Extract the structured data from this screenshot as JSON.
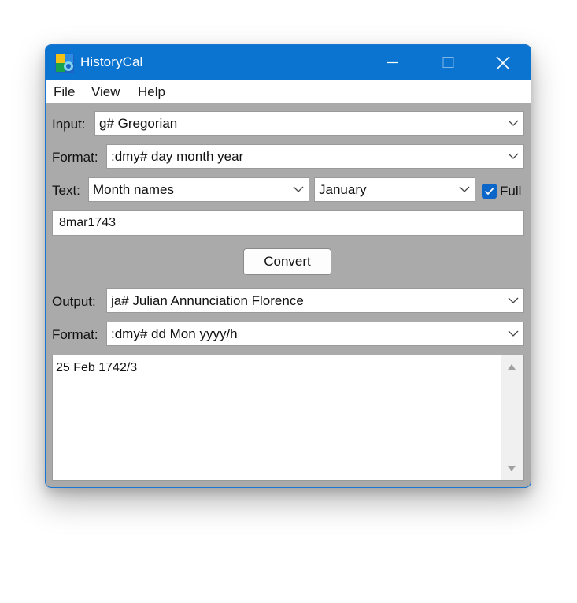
{
  "window": {
    "title": "HistoryCal",
    "controls": {
      "minimize": "minimize-icon",
      "maximize": "maximize-icon",
      "close": "close-icon"
    },
    "accent_color": "#0a74d0"
  },
  "menu": [
    "File",
    "View",
    "Help"
  ],
  "input": {
    "label": "Input:",
    "calendar": "g#  Gregorian",
    "format_label": "Format:",
    "format": ":dmy#  day month year",
    "text_label": "Text:",
    "text_mode": "Month names",
    "text_month": "January",
    "full_label": "Full",
    "full_checked": true,
    "date_value": "8mar1743"
  },
  "convert_label": "Convert",
  "output": {
    "label": "Output:",
    "calendar": "ja#  Julian Annunciation Florence",
    "format_label": "Format:",
    "format": ":dmy#  dd Mon yyyy/h",
    "result": "25 Feb 1742/3"
  }
}
